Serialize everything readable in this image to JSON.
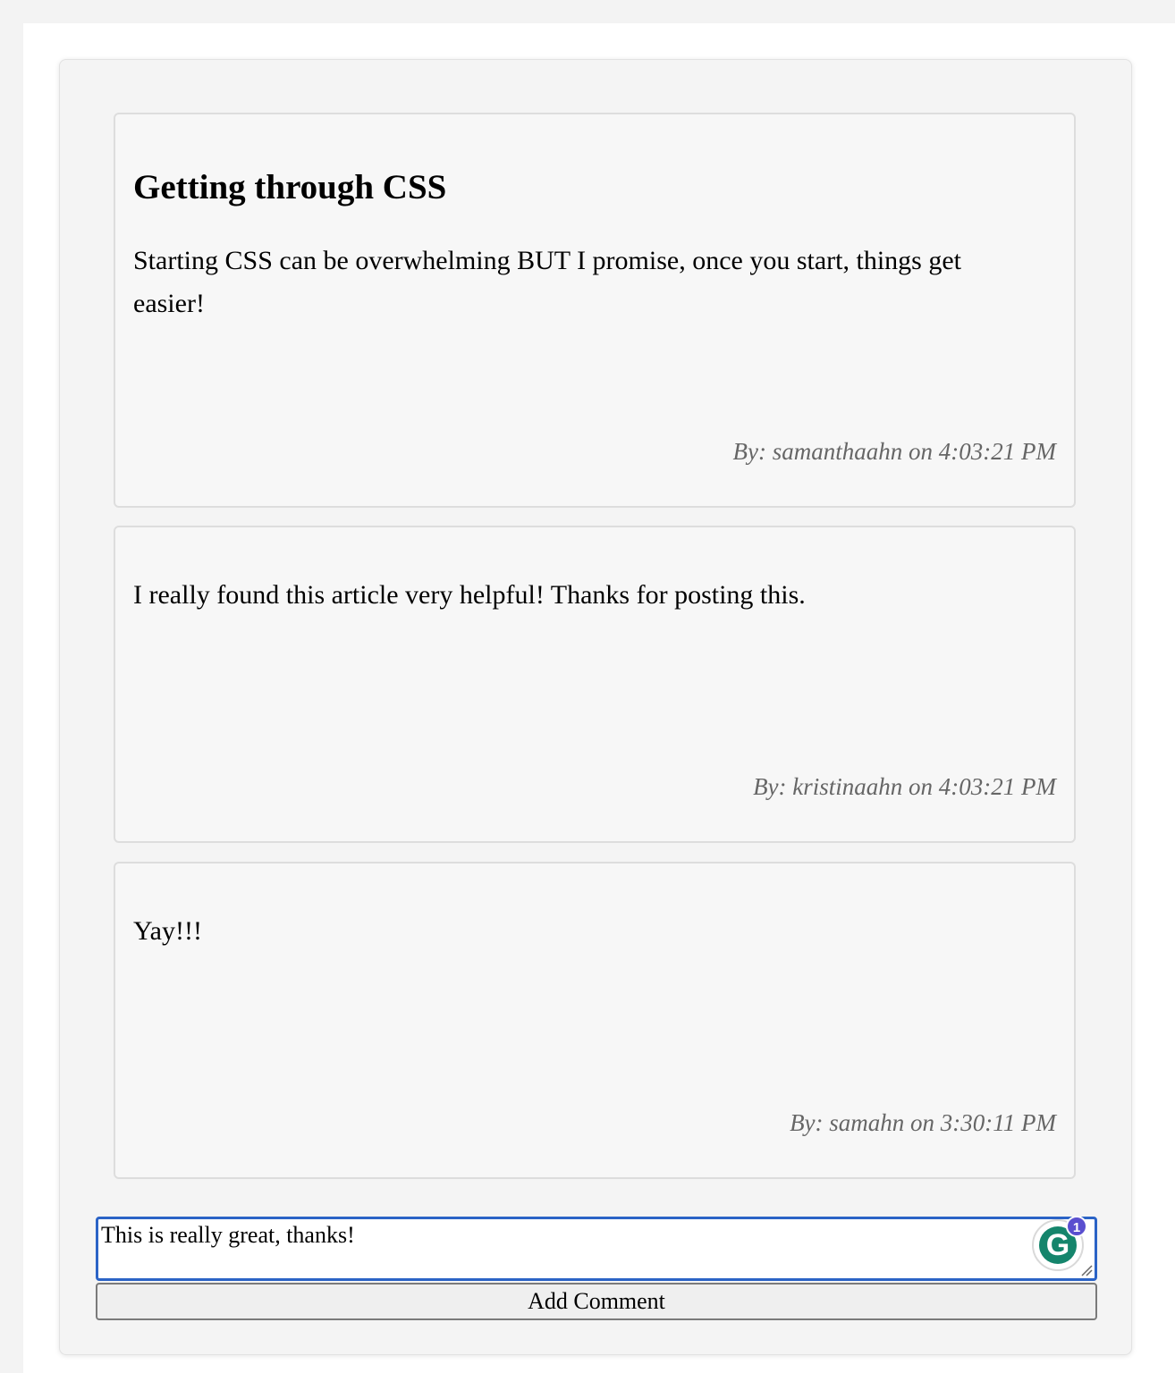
{
  "post": {
    "title": "Getting through CSS",
    "body": "Starting CSS can be overwhelming BUT I promise, once you start, things get easier!",
    "byline": "By: samanthaahn on 4:03:21 PM"
  },
  "comments": [
    {
      "body": "I really found this article very helpful! Thanks for posting this.",
      "byline": "By: kristinaahn on 4:03:21 PM"
    },
    {
      "body": "Yay!!!",
      "byline": "By: samahn on 3:30:11 PM"
    }
  ],
  "comment_form": {
    "value": "This is really great, thanks!",
    "button_label": "Add Comment"
  },
  "grammar_badge": {
    "icon": "grammarly-g-icon",
    "letter": "G",
    "count": "1"
  },
  "colors": {
    "input_focus_border": "#2b63c6",
    "byline_text": "#666666",
    "badge_green": "#15856c",
    "badge_count": "#5a4fcf"
  }
}
